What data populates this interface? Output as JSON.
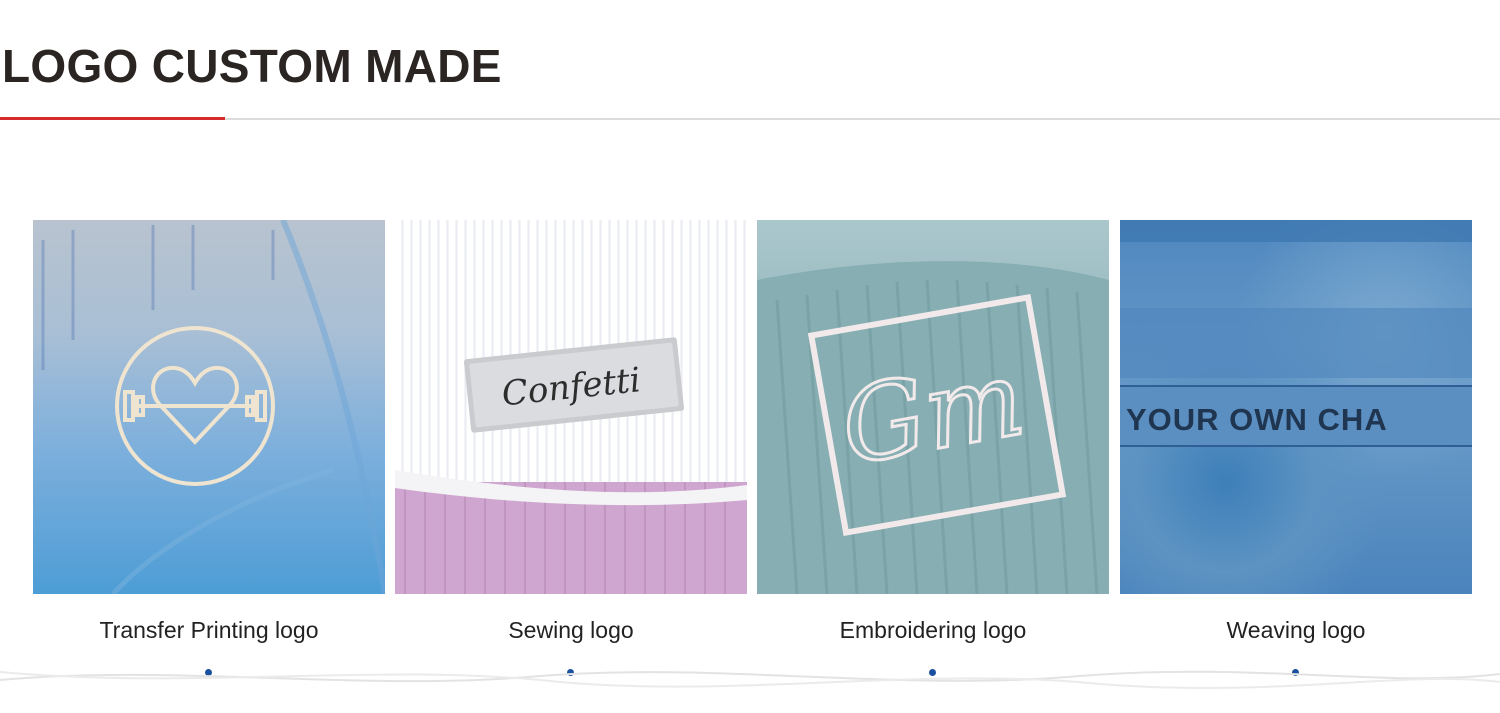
{
  "page": {
    "title": "LOGO CUSTOM MADE"
  },
  "theme": {
    "accent": "#d42a2a",
    "dot": "#1b4fa0",
    "rule": "#dcdcdc"
  },
  "cards": [
    {
      "caption": "Transfer Printing logo"
    },
    {
      "caption": "Sewing logo",
      "label_text": "Confetti"
    },
    {
      "caption": "Embroidering logo",
      "monogram": "Gm"
    },
    {
      "caption": "Weaving logo",
      "woven_text": "YOUR OWN CHA"
    }
  ]
}
